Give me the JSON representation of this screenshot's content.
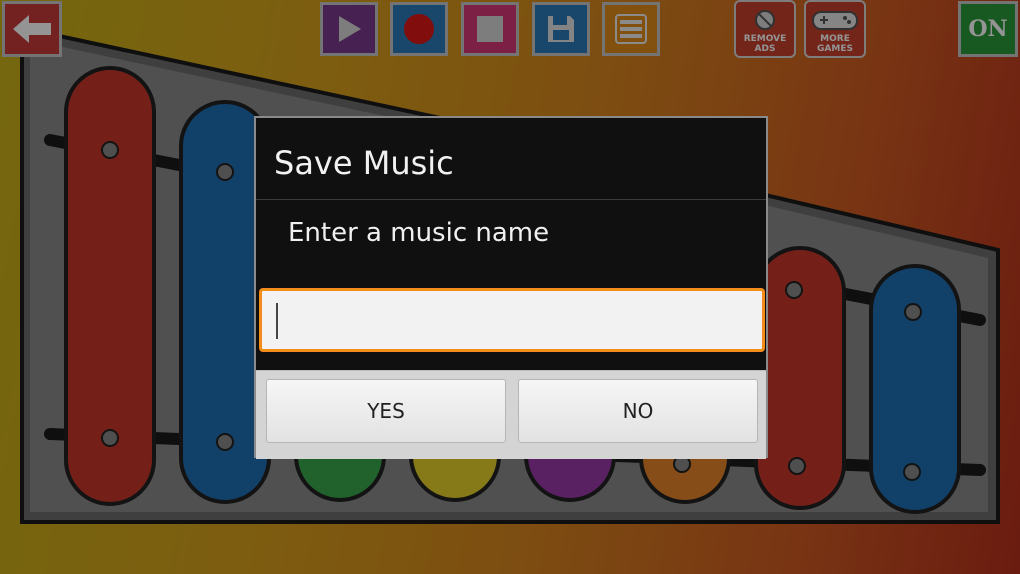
{
  "toolbar": {
    "back_icon": "arrow-left-icon",
    "play_icon": "play-icon",
    "record_icon": "record-icon",
    "stop_icon": "stop-icon",
    "save_icon": "floppy-disk-icon",
    "list_icon": "list-icon",
    "remove_ads_label": "REMOVE ADS",
    "more_games_label": "MORE GAMES",
    "power_label": "ON"
  },
  "colors": {
    "play": "#7a3a8c",
    "record": "#2a7ab8",
    "stop": "#d63a78",
    "save": "#2a7ab8",
    "list": "#e08a1a",
    "input_focus": "#f28c1a"
  },
  "xylophone": {
    "bars": [
      "red",
      "blue",
      "green",
      "yellow",
      "purple",
      "orange",
      "red",
      "blue"
    ]
  },
  "dialog": {
    "title": "Save Music",
    "message": "Enter a music name",
    "input_value": "",
    "yes_label": "YES",
    "no_label": "NO"
  }
}
